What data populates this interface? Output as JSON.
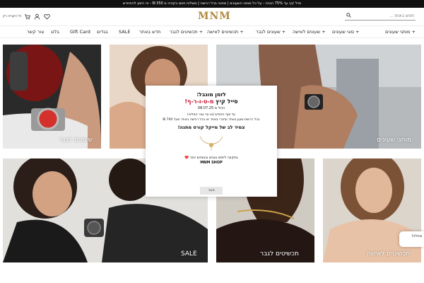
{
  "announcement": "סייל קיץ עד 75% הנחה - על כל מותגי השעונים | מתנה בכל רכישה | משלוח חינם בקנייה מ 350 ₪ - זה הזמן להתחדש",
  "header": {
    "search_placeholder": "חפש באתר...",
    "logo": "MNM",
    "account_label": "כל הקנייה רק"
  },
  "nav": [
    "+ מותגי שעונים",
    "+ סוגי שעונים",
    "+ שעונים לאישה",
    "+ שעונים לגבר",
    "+ תכשיטים לאישה",
    "+ תכשיטים לגבר",
    "חדש באתר",
    "SALE",
    "בגדים",
    "Gift Card",
    "בלוג",
    "צור קשר"
  ],
  "panels": {
    "watches_men": "שעונים לגבר",
    "brands": "מותגי שעונים",
    "sale": "SALE",
    "jewelry_men": "תכשיטים לגבר",
    "jewelry_women": "תכשיטים לאישה"
  },
  "modal": {
    "line1": "לזמן מוגבל:",
    "line2_prefix": "סייל קיץ ",
    "line2_highlight": "מ-ט-ו-ר-ף!",
    "line3": "החל מ 08.07.25",
    "line4": "עד סוף החודש (או עד גמר המלאי)",
    "line5": "בכל רכישת שעון באתר ובזכרי באתר או בכל רכישה באתר מעל 700 ₪",
    "line6": "צמיד לב של מייקל קורס מתנה!",
    "line7": "בתקווה לימים טובים ובטוחים יותר ❤️",
    "line8": "MNM SHOP",
    "close_label": "סגור"
  },
  "chat_label": "מחלה!",
  "colors": {
    "accent_red": "#c8102e",
    "logo_gold": "#b08a3e",
    "topbar": "#111111"
  }
}
